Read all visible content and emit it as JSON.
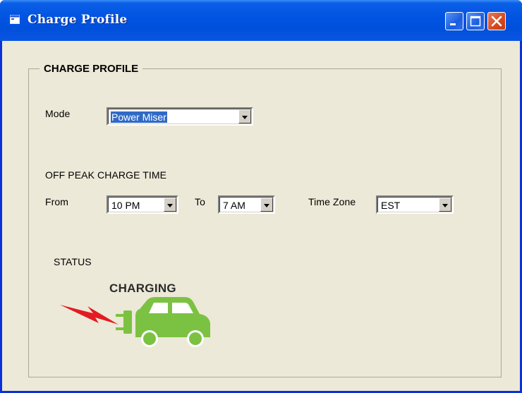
{
  "window": {
    "title": "Charge Profile",
    "controls": [
      "minimize-icon",
      "maximize-icon",
      "close-icon"
    ]
  },
  "group": {
    "title": "CHARGE PROFILE"
  },
  "mode": {
    "label": "Mode",
    "value": "Power Miser"
  },
  "off_peak": {
    "heading": "OFF PEAK CHARGE TIME",
    "from_label": "From",
    "from_value": "10 PM",
    "to_label": "To",
    "to_value": "7 AM",
    "timezone_label": "Time Zone",
    "timezone_value": "EST"
  },
  "status": {
    "label": "STATUS",
    "state": "CHARGING",
    "icon": "charging-car-icon",
    "colors": {
      "car": "#7cc242",
      "bolt": "#e31b23"
    }
  },
  "colors": {
    "titlebar": "#0053e1",
    "window_bg": "#ece9d8",
    "selection": "#316ac5",
    "close_button": "#d7491f"
  }
}
